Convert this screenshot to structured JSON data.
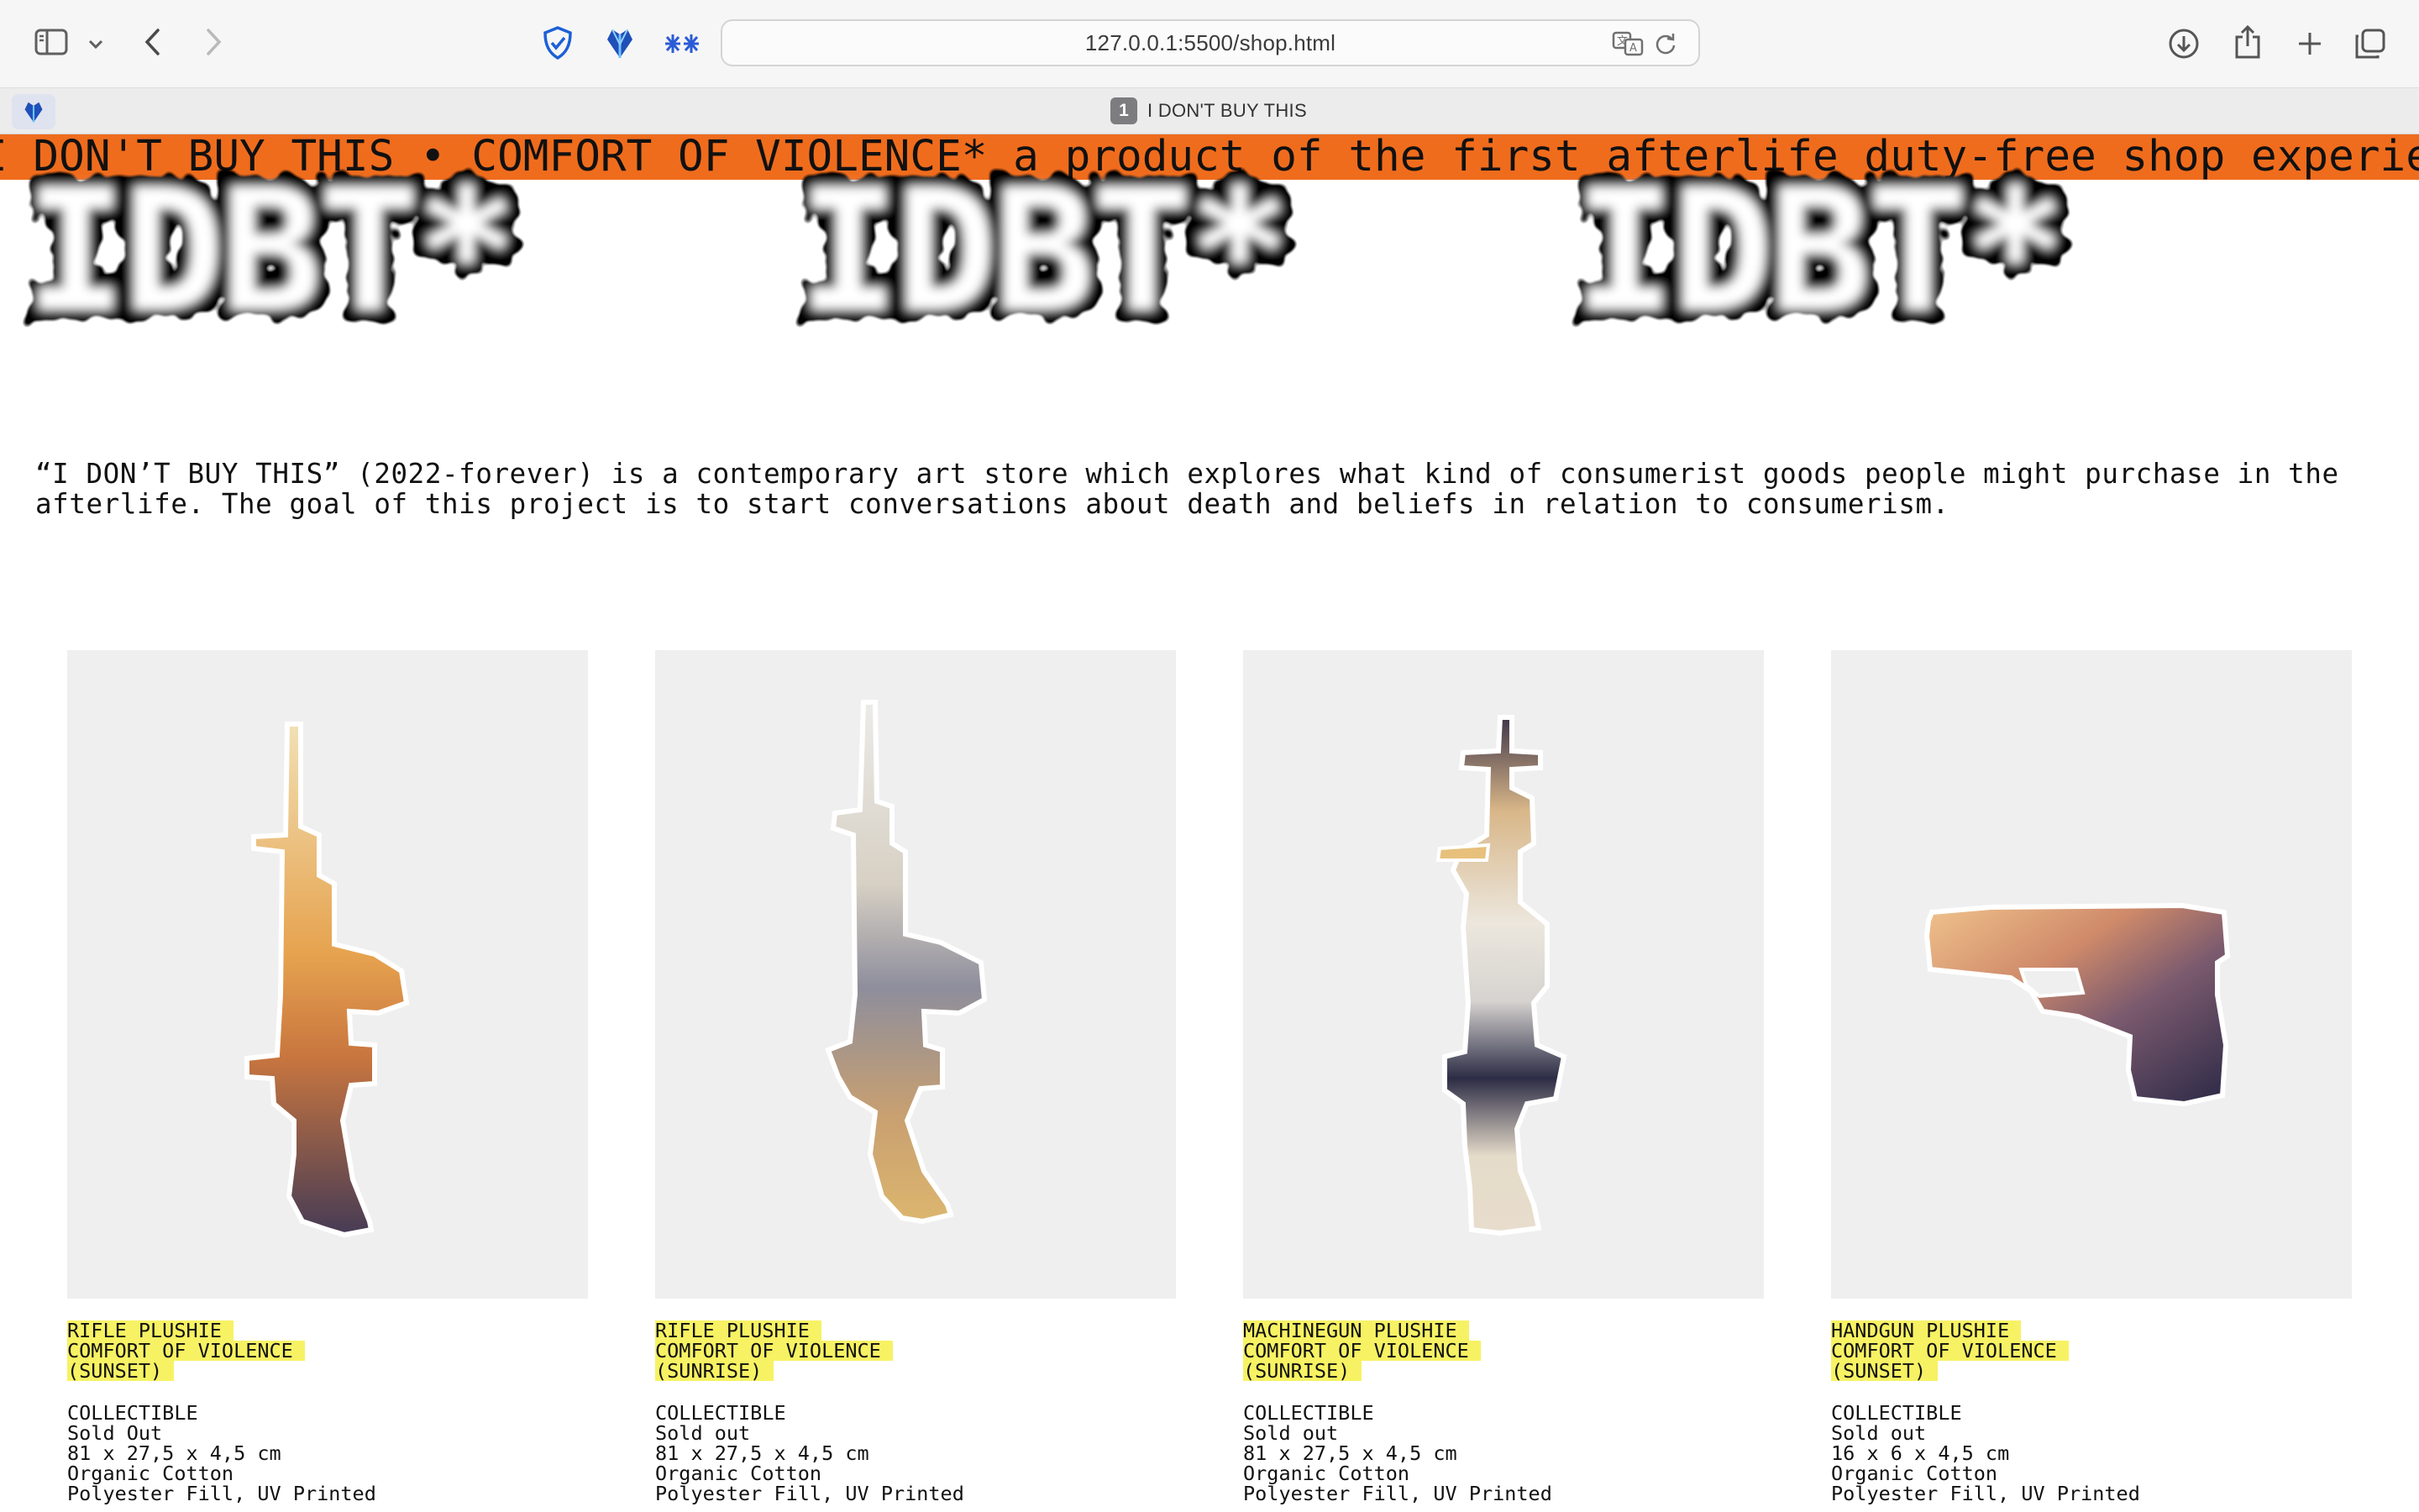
{
  "browser": {
    "url": "127.0.0.1:5500/shop.html",
    "tab_number": "1",
    "tab_title": "I DON'T BUY THIS",
    "toolbar_icons": [
      "sidebar-icon",
      "chevron-down-icon",
      "back-icon",
      "forward-icon",
      "shield-icon",
      "heart-extension-icon",
      "sparkle-extension-icon",
      "translate-icon",
      "reload-icon",
      "download-icon",
      "share-icon",
      "new-tab-icon",
      "tabs-overview-icon"
    ]
  },
  "page": {
    "marquee": "I DON'T BUY THIS • COMFORT OF VIOLENCE* a product of the first afterlife duty-free shop experience",
    "logo_text": "IDBT*",
    "intro": "“I DON’T BUY THIS” (2022-forever) is a contemporary art store which explores what kind of consumerist goods people might purchase in the afterlife. The goal of this project is to start conversations about death and beliefs in relation to consumerism.",
    "colors": {
      "marquee_bg": "#f06c1d",
      "highlight": "#f7f263",
      "card_bg": "#efefef"
    }
  },
  "products": [
    {
      "name": "RIFLE PLUSHIE",
      "collection": "COMFORT OF VIOLENCE",
      "variant": "(SUNSET)",
      "type": "COLLECTIBLE",
      "status": "Sold Out",
      "dimensions": "81 x 27,5 x 4,5 cm",
      "material": "Organic Cotton",
      "fill": "Polyester Fill, UV Printed"
    },
    {
      "name": "RIFLE PLUSHIE",
      "collection": "COMFORT OF VIOLENCE",
      "variant": "(SUNRISE)",
      "type": "COLLECTIBLE",
      "status": "Sold out",
      "dimensions": "81 x 27,5 x 4,5 cm",
      "material": "Organic Cotton",
      "fill": "Polyester Fill, UV Printed"
    },
    {
      "name": "MACHINEGUN PLUSHIE",
      "collection": "COMFORT OF VIOLENCE",
      "variant": "(SUNRISE)",
      "type": "COLLECTIBLE",
      "status": "Sold out",
      "dimensions": "81 x 27,5 x 4,5 cm",
      "material": "Organic Cotton",
      "fill": "Polyester Fill, UV Printed"
    },
    {
      "name": "HANDGUN PLUSHIE",
      "collection": "COMFORT OF VIOLENCE",
      "variant": "(SUNSET)",
      "type": "COLLECTIBLE",
      "status": "Sold out",
      "dimensions": "16 x 6 x 4,5 cm",
      "material": "Organic Cotton",
      "fill": "Polyester Fill, UV Printed"
    }
  ]
}
